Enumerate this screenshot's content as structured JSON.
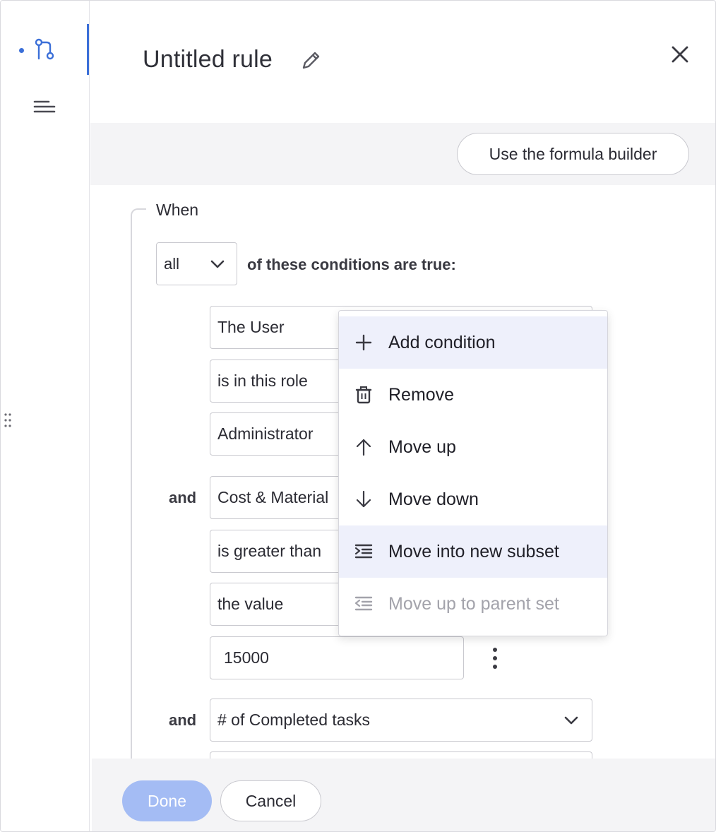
{
  "header": {
    "title": "Untitled rule"
  },
  "toolbar": {
    "formula_builder_label": "Use the formula builder"
  },
  "when": {
    "label": "When",
    "quantifier": "all",
    "conditions_text": "of these conditions are true:"
  },
  "conditions": {
    "group1": {
      "subject": "The User",
      "operator": "is in this role",
      "value": "Administrator"
    },
    "group2": {
      "connector": "and",
      "subject": "Cost & Material",
      "operator": "is greater than",
      "value_type": "the value",
      "value": "15000"
    },
    "group3": {
      "connector": "and",
      "subject": "# of Completed tasks"
    }
  },
  "context_menu": {
    "items": [
      {
        "label": "Add condition",
        "icon": "plus-icon"
      },
      {
        "label": "Remove",
        "icon": "trash-icon"
      },
      {
        "label": "Move up",
        "icon": "arrow-up-icon"
      },
      {
        "label": "Move down",
        "icon": "arrow-down-icon"
      },
      {
        "label": "Move into new subset",
        "icon": "indent-icon"
      },
      {
        "label": "Move up to parent set",
        "icon": "outdent-icon"
      }
    ]
  },
  "footer": {
    "done_label": "Done",
    "cancel_label": "Cancel"
  },
  "colors": {
    "accent": "#3b6fd8",
    "done_disabled": "#a4bcf4",
    "menu_highlight": "#eef0fb",
    "panel_gray": "#f4f4f6"
  }
}
